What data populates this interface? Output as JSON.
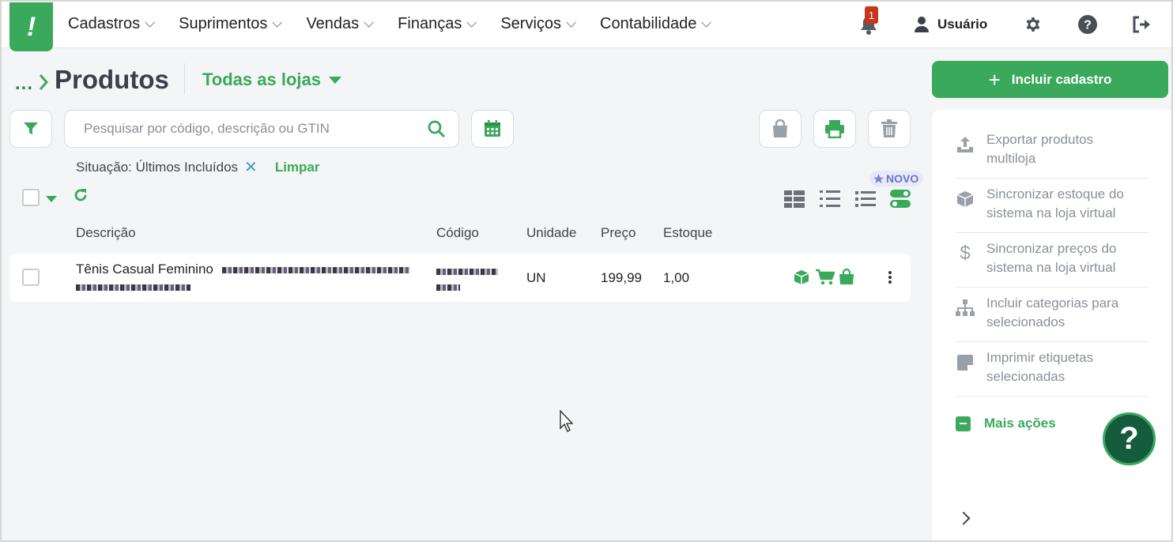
{
  "nav": {
    "items": [
      {
        "label": "Cadastros"
      },
      {
        "label": "Suprimentos"
      },
      {
        "label": "Vendas"
      },
      {
        "label": "Finanças"
      },
      {
        "label": "Serviços"
      },
      {
        "label": "Contabilidade"
      }
    ],
    "notification_count": "1",
    "user_label": "Usuário"
  },
  "header": {
    "breadcrumb": "...",
    "title": "Produtos",
    "store_select": "Todas as lojas"
  },
  "search": {
    "placeholder": "Pesquisar por código, descrição ou GTIN",
    "value": ""
  },
  "filters": {
    "active_label": "Situação: Últimos Incluídos",
    "remove": "✕",
    "clear_label": "Limpar"
  },
  "badges": {
    "new_label": "NOVO"
  },
  "table": {
    "columns": [
      "Descrição",
      "Código",
      "Unidade",
      "Preço",
      "Estoque"
    ],
    "rows": [
      {
        "description": "Tênis Casual Feminino",
        "unit": "UN",
        "price": "199,99",
        "stock": "1,00"
      }
    ]
  },
  "actions": {
    "add_label": "Incluir cadastro",
    "side_items": [
      {
        "label": "Exportar produtos multiloja",
        "icon": "upload-icon"
      },
      {
        "label": "Sincronizar estoque do sistema na loja virtual",
        "icon": "box-icon"
      },
      {
        "label": "Sincronizar preços do sistema na loja virtual",
        "icon": "dollar-icon"
      },
      {
        "label": "Incluir categorias para selecionados",
        "icon": "sitemap-icon"
      },
      {
        "label": "Imprimir etiquetas selecionadas",
        "icon": "sticky-note-icon"
      }
    ],
    "more_label": "Mais ações"
  },
  "help": {
    "label": "?"
  },
  "colors": {
    "brand_green": "#3aa95b",
    "dark_green": "#155c3e",
    "badge_red": "#c8361b"
  }
}
